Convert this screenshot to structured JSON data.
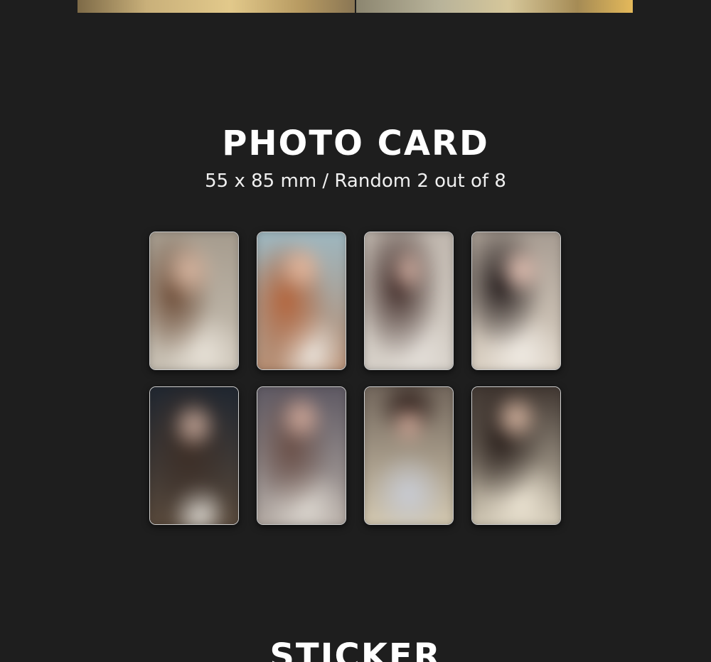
{
  "photo_card_section": {
    "title": "PHOTO CARD",
    "subtitle": "55 x 85 mm / Random 2 out of 8",
    "cards": [
      {
        "name": "photo-card-1"
      },
      {
        "name": "photo-card-2"
      },
      {
        "name": "photo-card-3"
      },
      {
        "name": "photo-card-4"
      },
      {
        "name": "photo-card-5"
      },
      {
        "name": "photo-card-6"
      },
      {
        "name": "photo-card-7"
      },
      {
        "name": "photo-card-8"
      }
    ]
  },
  "sticker_section": {
    "title": "STICKER"
  },
  "colors": {
    "background": "#1e1e1e",
    "text": "#ffffff",
    "card_border": "#cfcfcf"
  }
}
